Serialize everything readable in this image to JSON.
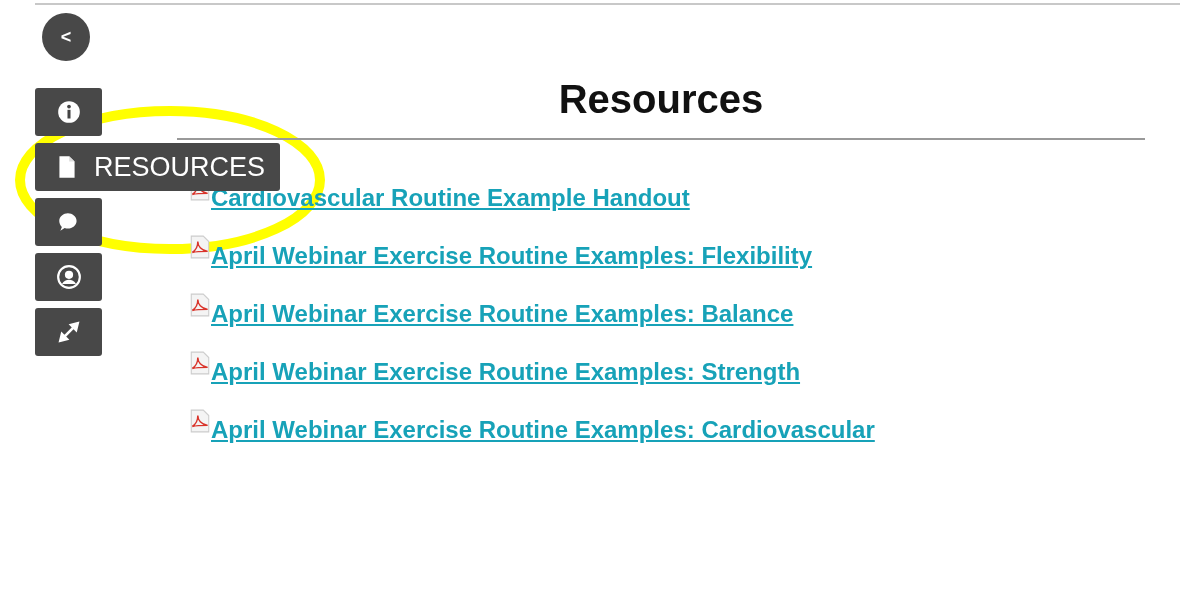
{
  "back_button": {
    "label": "<"
  },
  "sidebar": [
    {
      "kind": "info",
      "expanded": false
    },
    {
      "kind": "document",
      "expanded": true,
      "label": "RESOURCES"
    },
    {
      "kind": "chat",
      "expanded": false
    },
    {
      "kind": "user",
      "expanded": false
    },
    {
      "kind": "expand",
      "expanded": false
    }
  ],
  "title": "Resources",
  "links": [
    {
      "label": "Cardiovascular Routine Example Handout"
    },
    {
      "label": "April Webinar Exercise Routine Examples: Flexibility"
    },
    {
      "label": "April Webinar Exercise Routine Examples: Balance"
    },
    {
      "label": "April Webinar Exercise Routine Examples: Strength"
    },
    {
      "label": "April Webinar Exercise Routine Examples: Cardiovascular"
    }
  ]
}
